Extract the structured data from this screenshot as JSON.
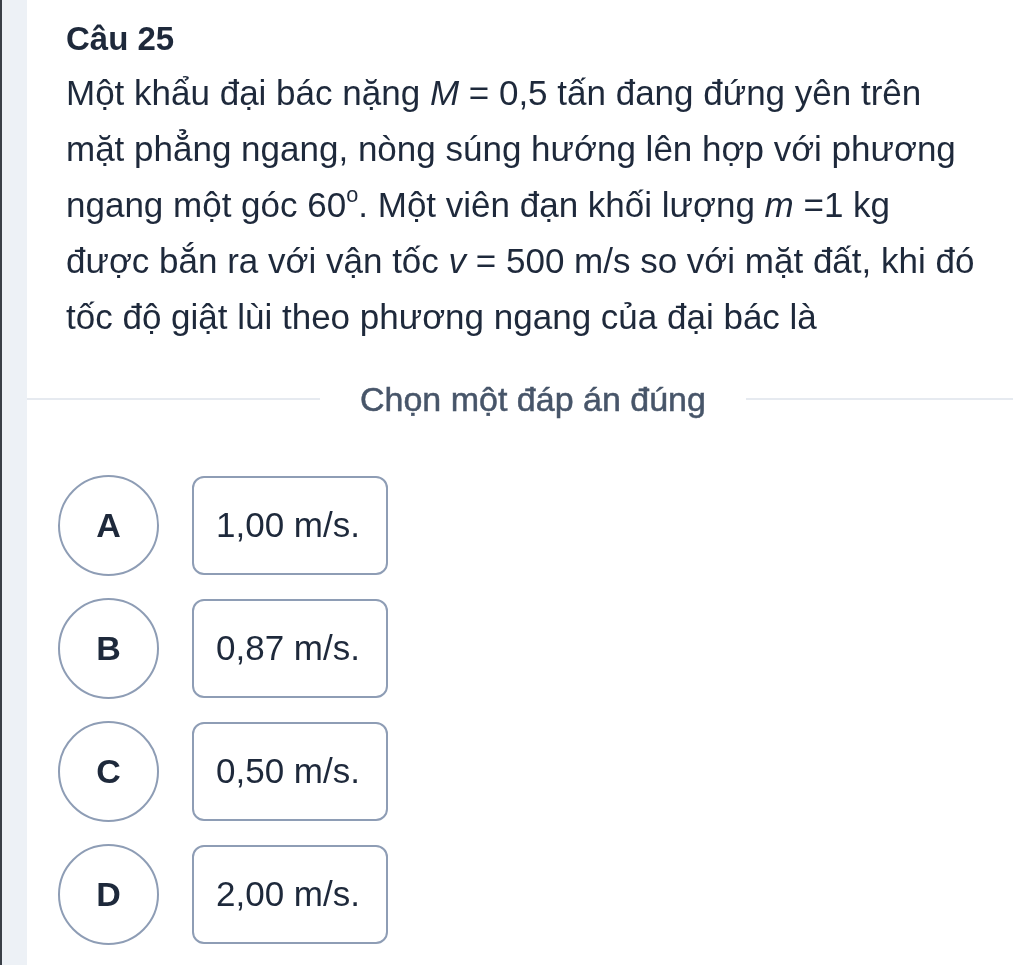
{
  "question": {
    "title": "Câu 25",
    "text": "Một khẩu đại bác nặng *M* = 0,5 tấn đang đứng yên trên mặt phẳng ngang, nòng súng hướng lên hợp với phương ngang một góc 60$^{o}$. Một viên đạn khối lượng *m* =1 kg được bắn ra với vận tốc *v* = 500 m/s so với mặt đất, khi đó tốc độ giật lùi theo phương ngang của đại bác là"
  },
  "instruction": "Chọn một đáp án đúng",
  "options": [
    {
      "letter": "A",
      "text": "1,00 m/s.",
      "selected": false
    },
    {
      "letter": "B",
      "text": "0,87 m/s.",
      "selected": false
    },
    {
      "letter": "C",
      "text": "0,50 m/s.",
      "selected": false
    },
    {
      "letter": "D",
      "text": "2,00 m/s.",
      "selected": false
    }
  ]
}
